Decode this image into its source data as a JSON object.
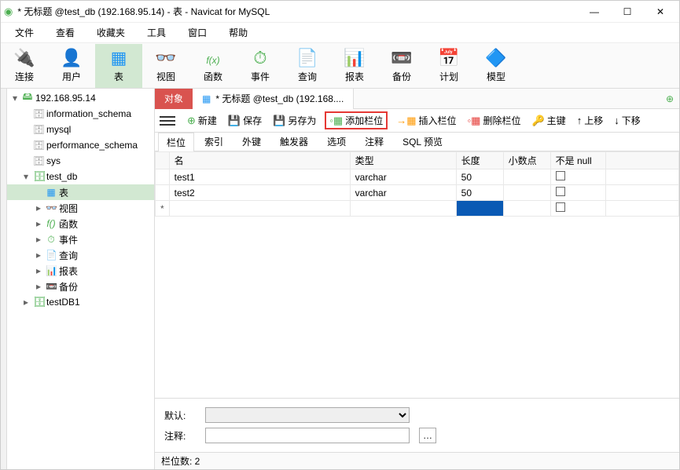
{
  "window": {
    "title": "* 无标题 @test_db (192.168.95.14) - 表 - Navicat for MySQL"
  },
  "menu": [
    "文件",
    "查看",
    "收藏夹",
    "工具",
    "窗口",
    "帮助"
  ],
  "main_toolbar": [
    {
      "label": "连接",
      "icon": "plug"
    },
    {
      "label": "用户",
      "icon": "user"
    },
    {
      "label": "表",
      "icon": "table",
      "active": true
    },
    {
      "label": "视图",
      "icon": "view"
    },
    {
      "label": "函数",
      "icon": "fx"
    },
    {
      "label": "事件",
      "icon": "event"
    },
    {
      "label": "查询",
      "icon": "query"
    },
    {
      "label": "报表",
      "icon": "report"
    },
    {
      "label": "备份",
      "icon": "backup"
    },
    {
      "label": "计划",
      "icon": "schedule"
    },
    {
      "label": "模型",
      "icon": "model"
    }
  ],
  "tree": {
    "conn": "192.168.95.14",
    "dbs": [
      "information_schema",
      "mysql",
      "performance_schema",
      "sys"
    ],
    "test_db": {
      "name": "test_db",
      "children": [
        "表",
        "视图",
        "函数",
        "事件",
        "查询",
        "报表",
        "备份"
      ]
    },
    "testDB1": "testDB1"
  },
  "tabs": {
    "object": "对象",
    "file": "* 无标题 @test_db (192.168...."
  },
  "sub_toolbar": {
    "new": "新建",
    "save": "保存",
    "save_as": "另存为",
    "add_field": "添加栏位",
    "insert_field": "插入栏位",
    "delete_field": "删除栏位",
    "primary_key": "主键",
    "move_up": "上移",
    "move_down": "下移"
  },
  "sub_tabs": [
    "栏位",
    "索引",
    "外键",
    "触发器",
    "选项",
    "注释",
    "SQL 预览"
  ],
  "grid": {
    "headers": {
      "name": "名",
      "type": "类型",
      "length": "长度",
      "decimals": "小数点",
      "not_null": "不是 null"
    },
    "rows": [
      {
        "name": "test1",
        "type": "varchar",
        "length": "50"
      },
      {
        "name": "test2",
        "type": "varchar",
        "length": "50"
      },
      {
        "name": "",
        "type": "",
        "length": "",
        "marker": "*"
      }
    ]
  },
  "form": {
    "default_label": "默认:",
    "comment_label": "注释:"
  },
  "status": {
    "field_count": "栏位数: 2"
  }
}
